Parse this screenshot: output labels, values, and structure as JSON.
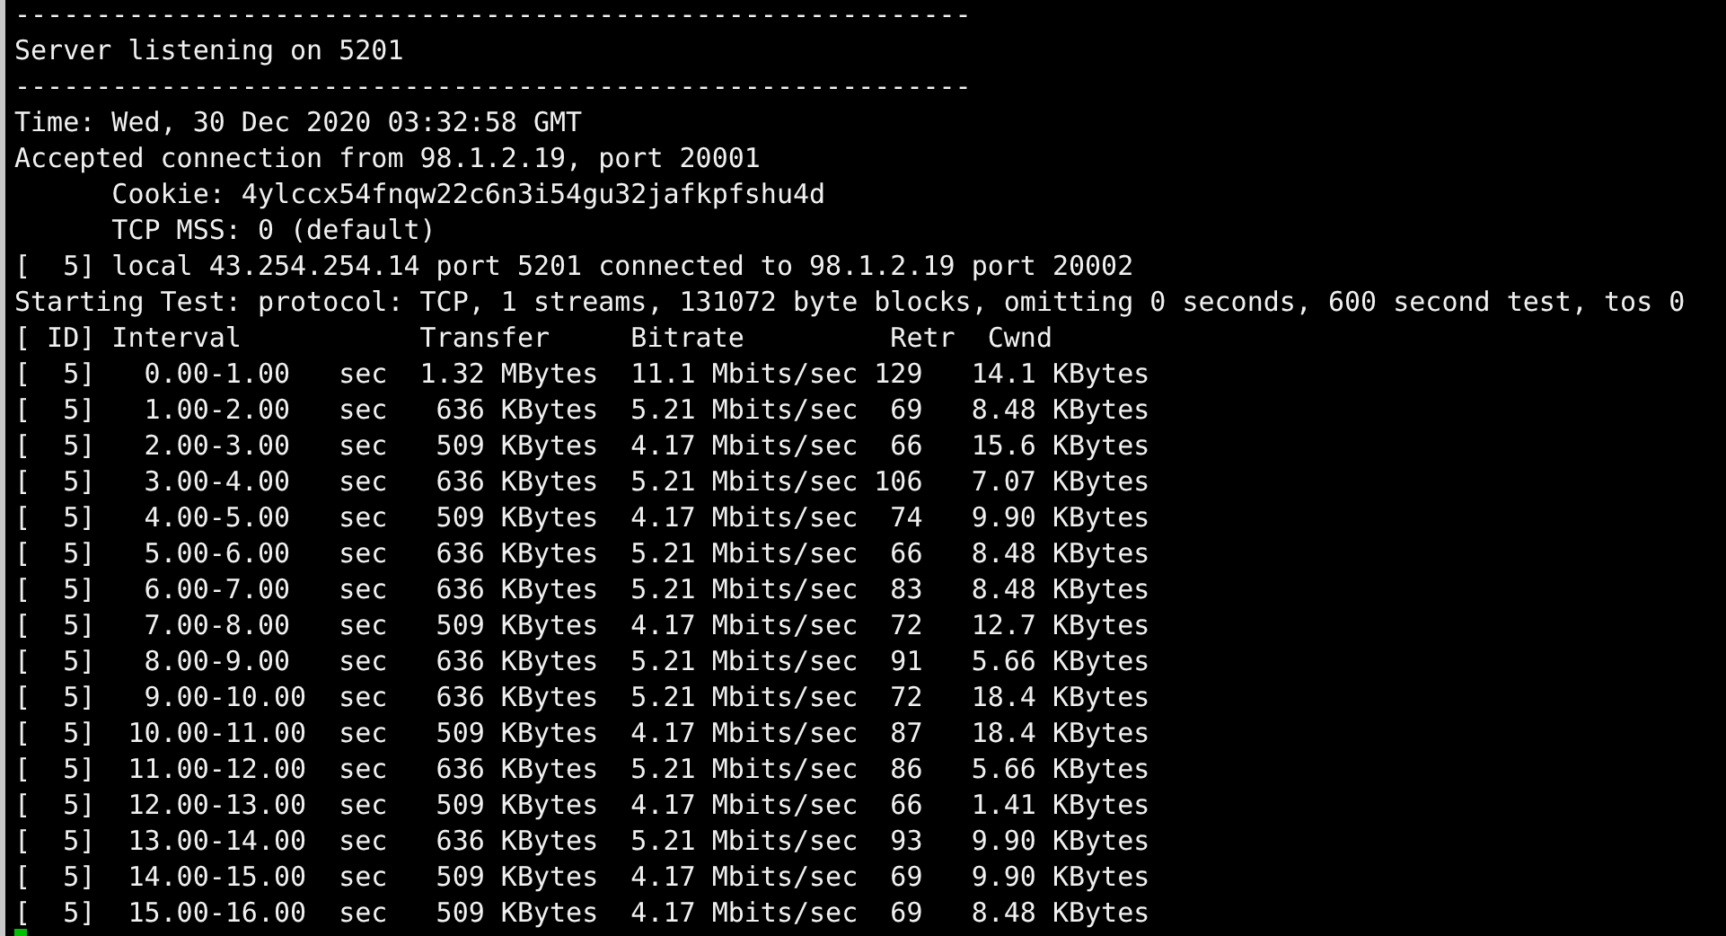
{
  "terminal": {
    "lines": [
      "-----------------------------------------------------------",
      "Server listening on 5201",
      "-----------------------------------------------------------",
      "Time: Wed, 30 Dec 2020 03:32:58 GMT",
      "Accepted connection from 98.1.2.19, port 20001",
      "      Cookie: 4ylccx54fnqw22c6n3i54gu32jafkpfshu4d",
      "      TCP MSS: 0 (default)",
      "[  5] local 43.254.254.14 port 5201 connected to 98.1.2.19 port 20002",
      "Starting Test: protocol: TCP, 1 streams, 131072 byte blocks, omitting 0 seconds, 600 second test, tos 0",
      "[ ID] Interval           Transfer     Bitrate         Retr  Cwnd",
      "[  5]   0.00-1.00   sec  1.32 MBytes  11.1 Mbits/sec 129   14.1 KBytes",
      "[  5]   1.00-2.00   sec   636 KBytes  5.21 Mbits/sec  69   8.48 KBytes",
      "[  5]   2.00-3.00   sec   509 KBytes  4.17 Mbits/sec  66   15.6 KBytes",
      "[  5]   3.00-4.00   sec   636 KBytes  5.21 Mbits/sec 106   7.07 KBytes",
      "[  5]   4.00-5.00   sec   509 KBytes  4.17 Mbits/sec  74   9.90 KBytes",
      "[  5]   5.00-6.00   sec   636 KBytes  5.21 Mbits/sec  66   8.48 KBytes",
      "[  5]   6.00-7.00   sec   636 KBytes  5.21 Mbits/sec  83   8.48 KBytes",
      "[  5]   7.00-8.00   sec   509 KBytes  4.17 Mbits/sec  72   12.7 KBytes",
      "[  5]   8.00-9.00   sec   636 KBytes  5.21 Mbits/sec  91   5.66 KBytes",
      "[  5]   9.00-10.00  sec   636 KBytes  5.21 Mbits/sec  72   18.4 KBytes",
      "[  5]  10.00-11.00  sec   509 KBytes  4.17 Mbits/sec  87   18.4 KBytes",
      "[  5]  11.00-12.00  sec   636 KBytes  5.21 Mbits/sec  86   5.66 KBytes",
      "[  5]  12.00-13.00  sec   509 KBytes  4.17 Mbits/sec  66   1.41 KBytes",
      "[  5]  13.00-14.00  sec   636 KBytes  5.21 Mbits/sec  93   9.90 KBytes",
      "[  5]  14.00-15.00  sec   509 KBytes  4.17 Mbits/sec  69   9.90 KBytes",
      "[  5]  15.00-16.00  sec   509 KBytes  4.17 Mbits/sec  69   8.48 KBytes"
    ]
  }
}
